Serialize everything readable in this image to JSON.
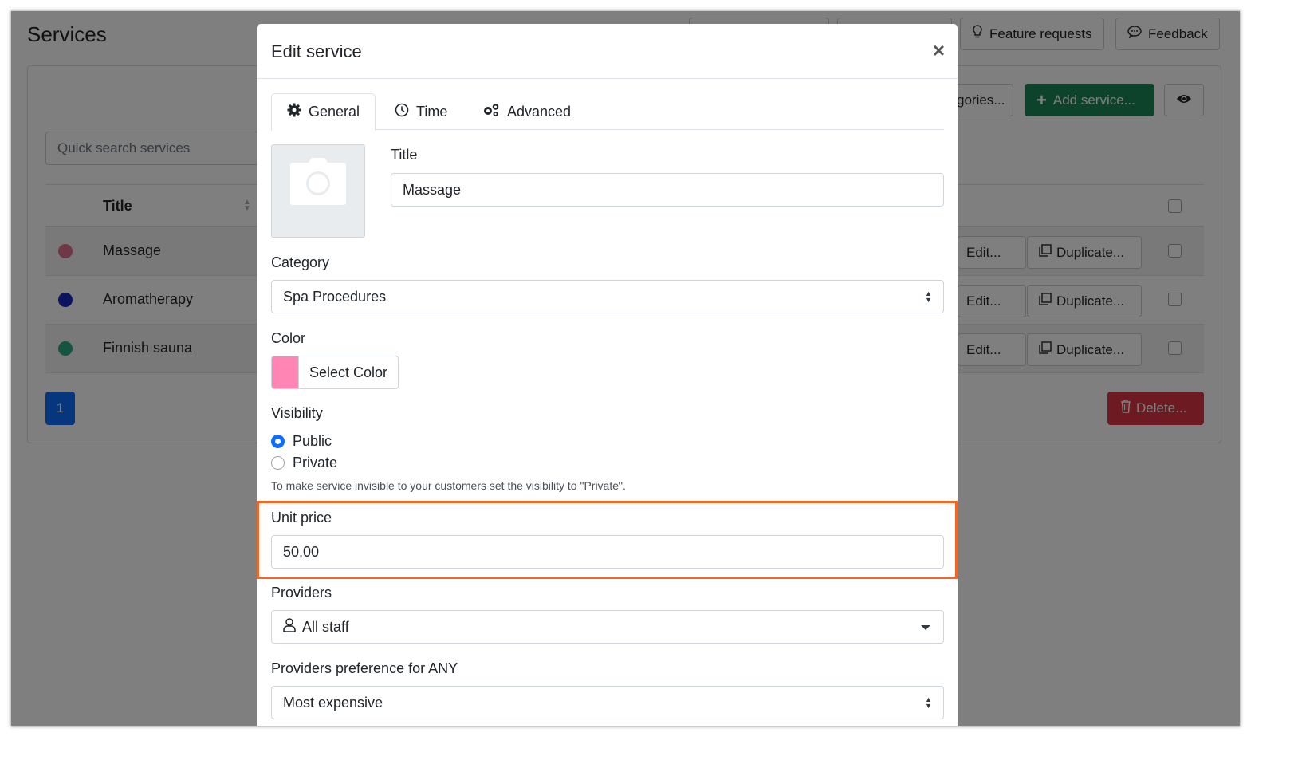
{
  "page": {
    "title": "Services",
    "top_buttons": [
      "Feature requests",
      "Feedback"
    ],
    "search_placeholder": "Quick search services",
    "categories_button": "gories...",
    "add_service_button": "Add service...",
    "table": {
      "title_header": "Title",
      "rows": [
        {
          "name": "Massage",
          "color": "#e0718f"
        },
        {
          "name": "Aromatherapy",
          "color": "#1728b8"
        },
        {
          "name": "Finnish sauna",
          "color": "#2ba882"
        }
      ],
      "edit_label": "Edit...",
      "duplicate_label": "Duplicate..."
    },
    "pagination_current": "1",
    "delete_button": "Delete..."
  },
  "modal": {
    "title": "Edit service",
    "close": "×",
    "tabs": [
      {
        "label": "General",
        "icon": "gear-icon",
        "active": true
      },
      {
        "label": "Time",
        "icon": "clock-icon",
        "active": false
      },
      {
        "label": "Advanced",
        "icon": "gears-icon",
        "active": false
      }
    ],
    "fields": {
      "title_label": "Title",
      "title_value": "Massage",
      "category_label": "Category",
      "category_value": "Spa Procedures",
      "color_label": "Color",
      "color_value": "#ff85b4",
      "color_button": "Select Color",
      "visibility_label": "Visibility",
      "visibility_options": [
        {
          "label": "Public",
          "checked": true
        },
        {
          "label": "Private",
          "checked": false
        }
      ],
      "visibility_help": "To make service invisible to your customers set the visibility to \"Private\".",
      "unit_price_label": "Unit price",
      "unit_price_value": "50,00",
      "providers_label": "Providers",
      "providers_value": "All staff",
      "providers_pref_label": "Providers preference for ANY",
      "providers_pref_value": "Most expensive"
    },
    "highlight_color": "#f26522"
  }
}
